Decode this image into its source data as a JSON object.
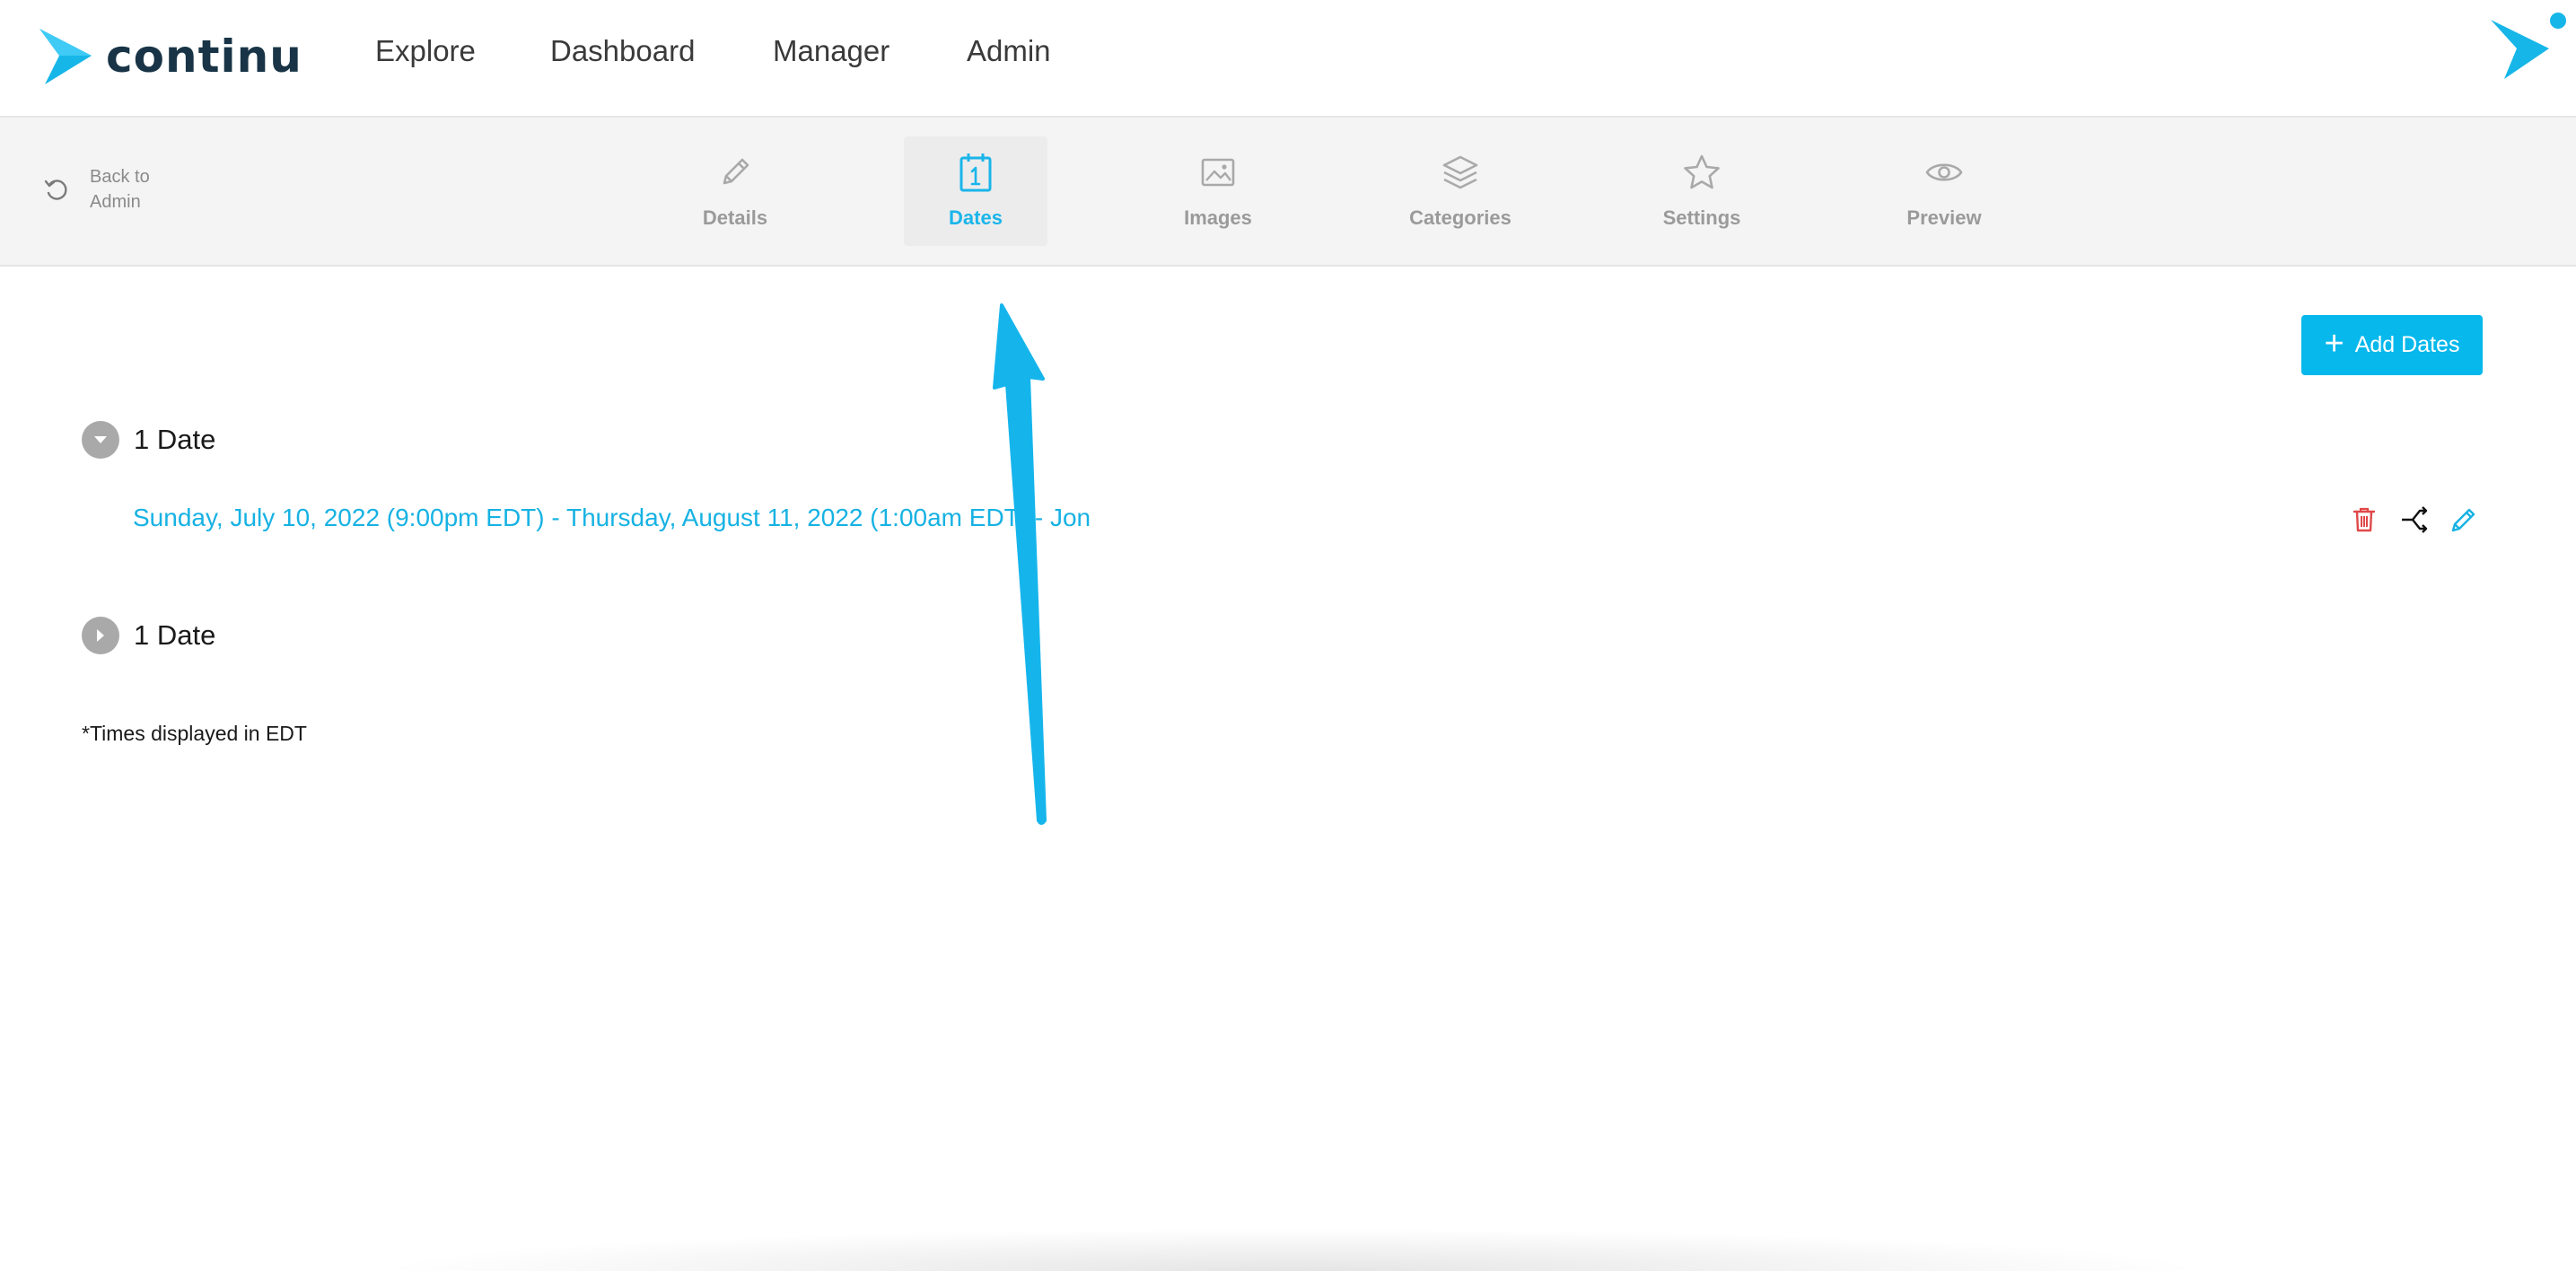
{
  "brand": {
    "name": "continu"
  },
  "nav": {
    "items": [
      {
        "label": "Explore"
      },
      {
        "label": "Dashboard"
      },
      {
        "label": "Manager"
      },
      {
        "label": "Admin"
      }
    ]
  },
  "subbar": {
    "back_label": "Back to Admin",
    "tabs": [
      {
        "label": "Details",
        "icon": "pencil-icon"
      },
      {
        "label": "Dates",
        "icon": "calendar-icon",
        "active": true
      },
      {
        "label": "Images",
        "icon": "image-icon"
      },
      {
        "label": "Categories",
        "icon": "layers-icon"
      },
      {
        "label": "Settings",
        "icon": "star-icon"
      },
      {
        "label": "Preview",
        "icon": "eye-icon"
      }
    ]
  },
  "main": {
    "add_dates_label": "Add Dates",
    "groups": [
      {
        "title": "1 Date",
        "expanded": true,
        "rows": [
          {
            "text": "Sunday, July 10, 2022 (9:00pm EDT) - Thursday, August 11, 2022 (1:00am EDT) - Jon"
          }
        ]
      },
      {
        "title": "1 Date",
        "expanded": false
      }
    ],
    "timezone_note": "*Times displayed in EDT"
  },
  "colors": {
    "accent": "#06b8ec",
    "brand_text": "#183446",
    "delete": "#e04848",
    "muted": "#9a9a9a"
  }
}
